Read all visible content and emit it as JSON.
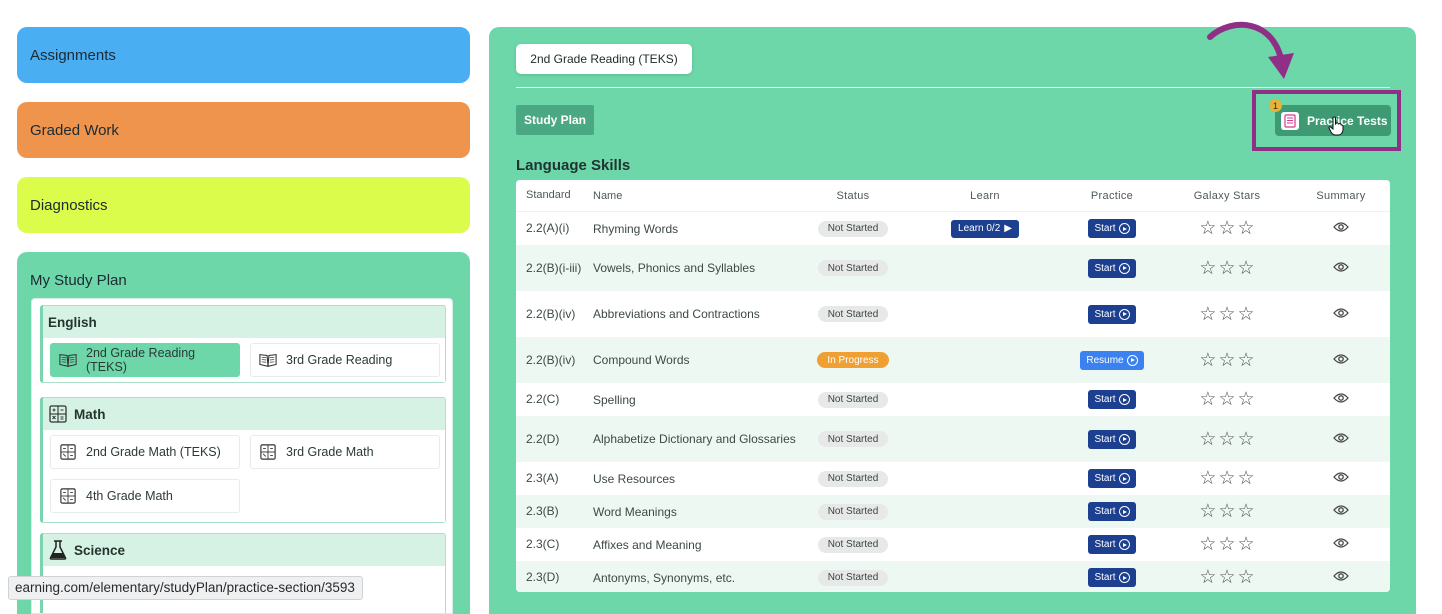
{
  "sidebar": {
    "assignments": "Assignments",
    "graded_work": "Graded Work",
    "diagnostics": "Diagnostics",
    "study_plan_title": "My Study Plan",
    "subjects": [
      {
        "name": "English",
        "icon": "none",
        "courses": [
          "2nd Grade Reading (TEKS)",
          "3rd Grade Reading"
        ]
      },
      {
        "name": "Math",
        "icon": "calculator-icon",
        "courses": [
          "2nd Grade Math (TEKS)",
          "3rd Grade Math",
          "4th Grade Math"
        ]
      },
      {
        "name": "Science",
        "icon": "flask-icon",
        "courses": []
      }
    ]
  },
  "status_bar_url": "earning.com/elementary/studyPlan/practice-section/3593",
  "main": {
    "course_tab": "2nd Grade Reading (TEKS)",
    "study_plan_button": "Study Plan",
    "practice_tests_button": "Practice Tests",
    "practice_tests_badge": "1",
    "section_title": "Language Skills",
    "columns": [
      "Standard",
      "Name",
      "Status",
      "Learn",
      "Practice",
      "Galaxy Stars",
      "Summary"
    ],
    "rows": [
      {
        "standard": "2.2(A)(i)",
        "name": "Rhyming Words",
        "status": "Not Started",
        "learn": "Learn 0/2",
        "practice": "Start",
        "stars": 0
      },
      {
        "standard": "2.2(B)(i-iii)",
        "name": "Vowels, Phonics and Syllables",
        "status": "Not Started",
        "learn": "",
        "practice": "Start",
        "stars": 0
      },
      {
        "standard": "2.2(B)(iv)",
        "name": "Abbreviations and Contractions",
        "status": "Not Started",
        "learn": "",
        "practice": "Start",
        "stars": 0
      },
      {
        "standard": "2.2(B)(iv)",
        "name": "Compound Words",
        "status": "In Progress",
        "learn": "",
        "practice": "Resume",
        "stars": 0
      },
      {
        "standard": "2.2(C)",
        "name": "Spelling",
        "status": "Not Started",
        "learn": "",
        "practice": "Start",
        "stars": 0
      },
      {
        "standard": "2.2(D)",
        "name": "Alphabetize Dictionary and Glossaries",
        "status": "Not Started",
        "learn": "",
        "practice": "Start",
        "stars": 0
      },
      {
        "standard": "2.3(A)",
        "name": "Use Resources",
        "status": "Not Started",
        "learn": "",
        "practice": "Start",
        "stars": 0
      },
      {
        "standard": "2.3(B)",
        "name": "Word Meanings",
        "status": "Not Started",
        "learn": "",
        "practice": "Start",
        "stars": 0
      },
      {
        "standard": "2.3(C)",
        "name": "Affixes and Meaning",
        "status": "Not Started",
        "learn": "",
        "practice": "Start",
        "stars": 0
      },
      {
        "standard": "2.3(D)",
        "name": "Antonyms, Synonyms, etc.",
        "status": "Not Started",
        "learn": "",
        "practice": "Start",
        "stars": 0
      }
    ]
  },
  "colors": {
    "panel_green": "#6dd7a9",
    "assignments_blue": "#4aaef3",
    "graded_orange": "#ef944d",
    "diagnostics_lime": "#dbfc4a",
    "button_navy": "#1d3f8f",
    "resume_blue": "#3b82f0",
    "in_progress_orange": "#f0a033",
    "highlight_purple": "#8f2f86"
  }
}
